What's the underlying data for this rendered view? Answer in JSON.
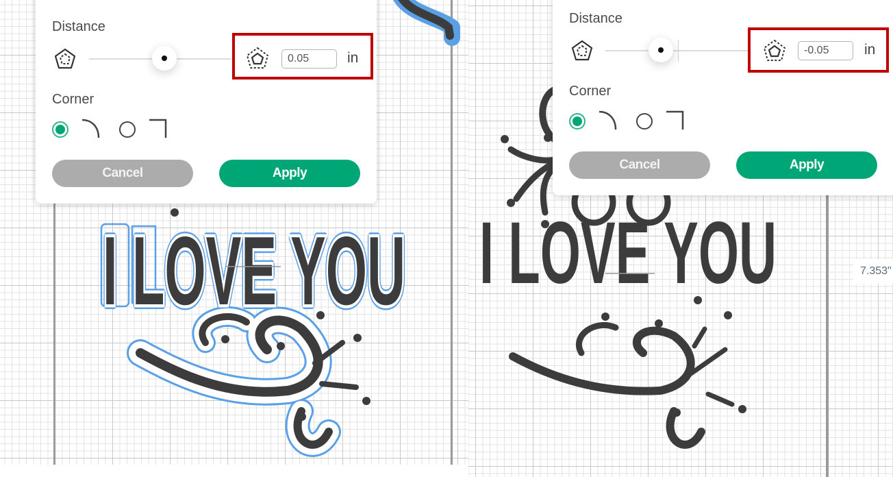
{
  "colors": {
    "accent_green": "#00a676",
    "cancel_gray": "#acacac",
    "highlight_red": "#c00000",
    "artwork_fill": "#3c3c3c",
    "offset_outline": "#5aa0e6"
  },
  "left_panel": {
    "distance_label": "Distance",
    "slider_min_icon": "pentagon-inset-icon",
    "slider_max_icon": "pentagon-outset-icon",
    "slider_value": 0.05,
    "distance_value": "0.05",
    "unit": "in",
    "corner_label": "Corner",
    "corner_options": [
      {
        "name": "rounded",
        "icon": "rounded-corner-icon",
        "selected": true
      },
      {
        "name": "square",
        "icon": "square-corner-icon",
        "selected": false
      }
    ],
    "cancel_label": "Cancel",
    "apply_label": "Apply"
  },
  "right_panel": {
    "distance_label": "Distance",
    "slider_min_icon": "pentagon-inset-icon",
    "slider_max_icon": "pentagon-outset-icon",
    "slider_value": -0.05,
    "distance_value": "-0.05",
    "unit": "in",
    "corner_label": "Corner",
    "corner_options": [
      {
        "name": "rounded",
        "icon": "rounded-corner-icon",
        "selected": true
      },
      {
        "name": "square",
        "icon": "square-corner-icon",
        "selected": false
      }
    ],
    "cancel_label": "Cancel",
    "apply_label": "Apply"
  },
  "canvas": {
    "artwork_text": "I LOVE YOU",
    "dimension_readout": "7.353\""
  }
}
